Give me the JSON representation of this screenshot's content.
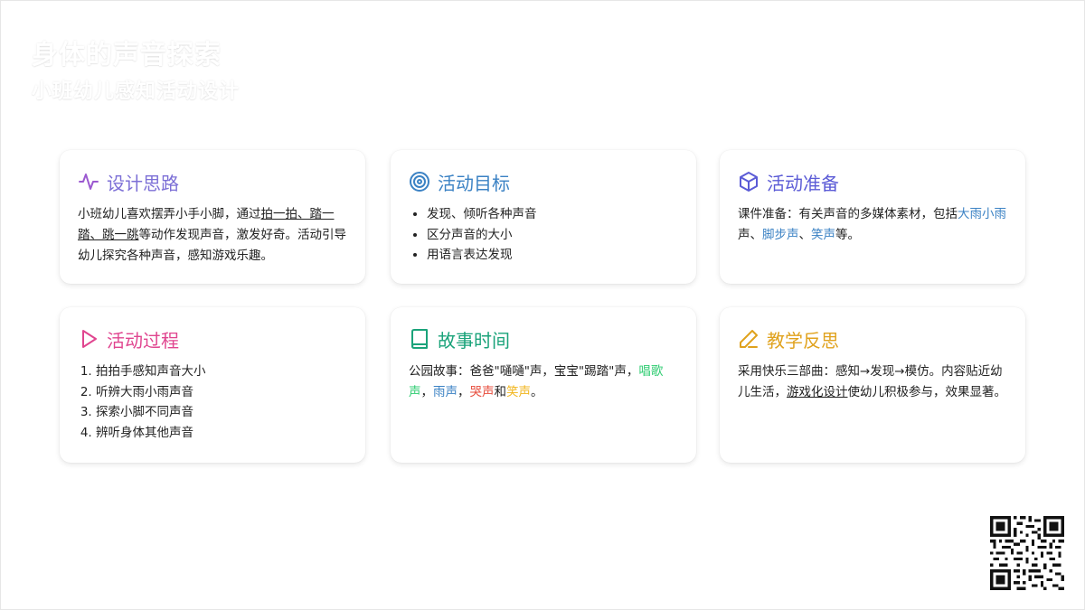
{
  "header": {
    "title": "身体的声音探索",
    "subtitle": "小班幼儿感知活动设计"
  },
  "cards": [
    {
      "title": "设计思路",
      "color": "#9b59d0",
      "icon": "activity-icon",
      "text_a": "小班幼儿喜欢摆弄小手小脚，通过",
      "text_link": "拍一拍、踏一踏、跳一跳",
      "text_b": "等动作发现声音，激发好奇。活动引导幼儿探究各种声音，感知游戏乐趣。"
    },
    {
      "title": "活动目标",
      "color": "#3b82c4",
      "icon": "target-icon",
      "items": [
        "发现、倾听各种声音",
        "区分声音的大小",
        "用语言表达发现"
      ]
    },
    {
      "title": "活动准备",
      "color": "#5b5bd6",
      "icon": "cube-icon",
      "text_a": "课件准备：有关声音的多媒体素材，包括",
      "hl1": "大雨小雨",
      "sep1": "声、",
      "hl2": "脚步声",
      "sep2": "、",
      "hl3": "笑声",
      "text_b": "等。",
      "hl_color": "#3b82c4"
    },
    {
      "title": "活动过程",
      "color": "#e0458f",
      "icon": "play-icon",
      "items": [
        "拍拍手感知声音大小",
        "听辨大雨小雨声音",
        "探索小脚不同声音",
        "辨听身体其他声音"
      ]
    },
    {
      "title": "故事时间",
      "color": "#1aa37a",
      "icon": "book-icon",
      "text_a": "公园故事：爸爸\"嗵嗵\"声，宝宝\"踢踏\"声，",
      "hl1": "唱歌声",
      "sep1": "，",
      "hl2": "雨声",
      "sep2": "，",
      "hl3": "哭声",
      "sep3": "和",
      "hl4": "笑声",
      "text_b": "。",
      "c1": "#2ecc71",
      "c2": "#3b82c4",
      "c3": "#e74c3c",
      "c4": "#f1b61f"
    },
    {
      "title": "教学反思",
      "color": "#e0a21d",
      "icon": "pencil-icon",
      "text_a": "采用快乐三部曲：感知→发现→模仿。内容贴近幼儿生活，",
      "text_link": "游戏化设计",
      "text_b": "使幼儿积极参与，效果显著。"
    }
  ]
}
